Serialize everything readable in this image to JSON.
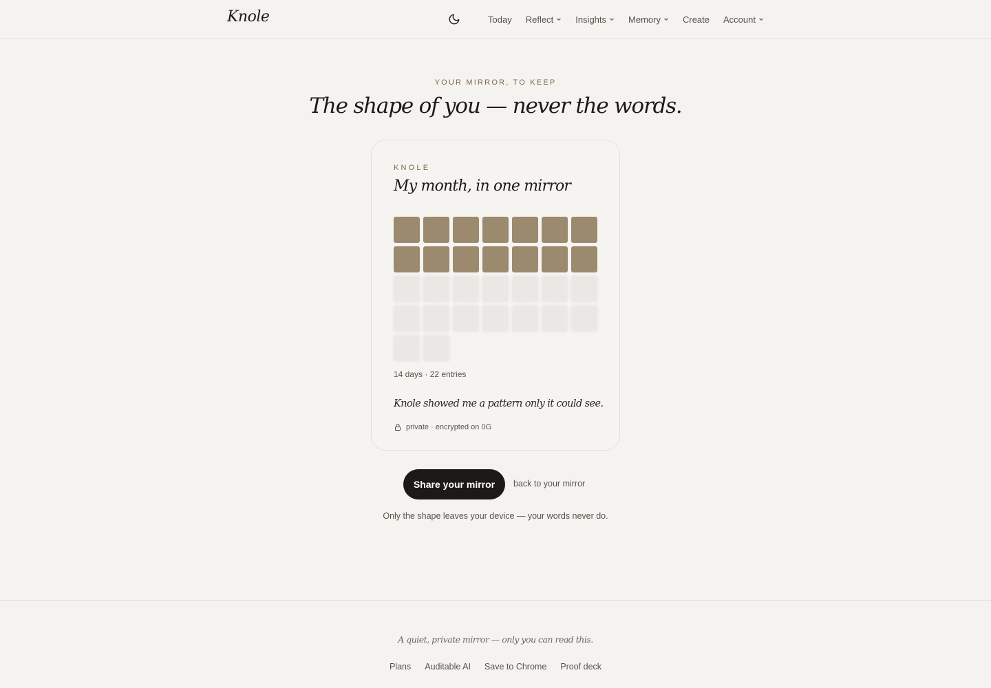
{
  "header": {
    "logo": "Knole",
    "theme_icon": "moon-icon",
    "nav": [
      {
        "label": "Today",
        "has_menu": false
      },
      {
        "label": "Reflect",
        "has_menu": true
      },
      {
        "label": "Insights",
        "has_menu": true
      },
      {
        "label": "Memory",
        "has_menu": true
      },
      {
        "label": "Create",
        "has_menu": false
      },
      {
        "label": "Account",
        "has_menu": true
      }
    ]
  },
  "hero": {
    "eyebrow": "YOUR MIRROR, TO KEEP",
    "headline": "The shape of you — never the words."
  },
  "card": {
    "brand": "KNOLE",
    "title": "My month, in one mirror",
    "days_total": 30,
    "days_filled": 14,
    "columns": 7,
    "stats": "14 days · 22 entries",
    "quote": "Knole showed me a pattern only it could see.",
    "privacy": "private · encrypted on 0G",
    "privacy_icon": "lock-icon"
  },
  "actions": {
    "share_label": "Share your mirror",
    "back_label": "back to your mirror",
    "note": "Only the shape leaves your device — your words never do."
  },
  "footer": {
    "tagline": "A quiet, private mirror — only you can read this.",
    "links": [
      "Plans",
      "Auditable AI",
      "Save to Chrome",
      "Proof deck"
    ]
  },
  "colors": {
    "background": "#f4f3f0",
    "accent": "#9b8a6d",
    "eyebrow": "#7d6a4d",
    "button": "#1c1a17"
  }
}
